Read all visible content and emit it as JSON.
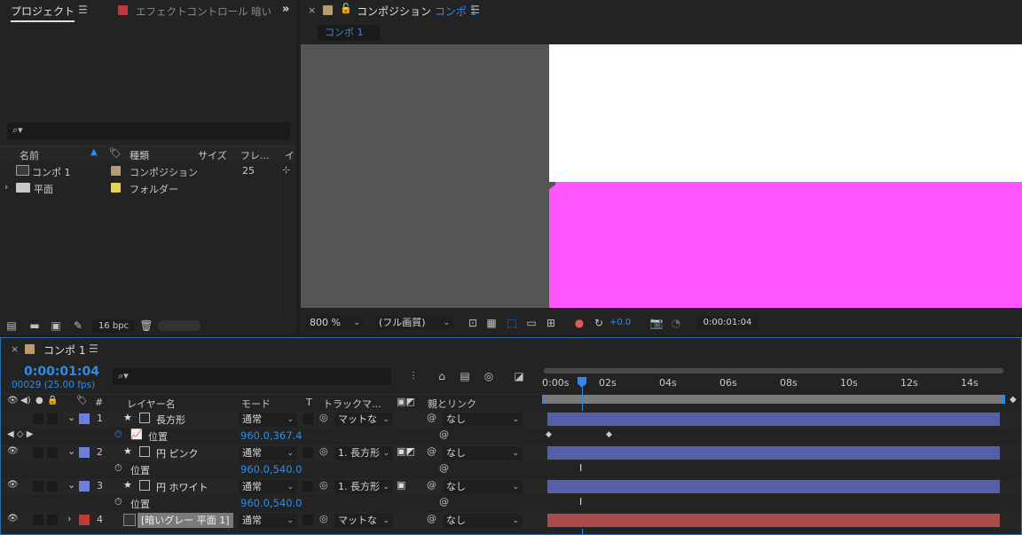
{
  "project_panel": {
    "tab_label": "プロジェクト",
    "effect_tab_label": "エフェクトコントロール 暗い",
    "columns": [
      "名前",
      "種類",
      "サイズ",
      "フレ...",
      "イ"
    ],
    "items": [
      {
        "name": "コンポ 1",
        "type": "コンポジション",
        "frame_rate": "25",
        "color": "#b89b72"
      },
      {
        "name": "平面",
        "type": "フォルダー",
        "frame_rate": "",
        "color": "#e8d44d"
      }
    ],
    "bpc_label": "16 bpc"
  },
  "comp_panel": {
    "tab_prefix": "コンポジション",
    "tab_name": "コンポ 1",
    "sub_tab": "コンポ 1",
    "zoom": "800 %",
    "resolution": "(フル画質)",
    "exposure": "+0.0",
    "timecode": "0:00:01:04"
  },
  "timeline": {
    "tab_label": "コンポ 1",
    "timecode": "0:00:01:04",
    "frame_info": "00029 (25.00 fps)",
    "headers": {
      "hash": "#",
      "layer_name": "レイヤー名",
      "mode": "モード",
      "t": "T",
      "track_matte": "トラックマ...",
      "parent": "親とリンク"
    },
    "ruler": [
      "0:00s",
      "02s",
      "04s",
      "06s",
      "08s",
      "10s",
      "12s",
      "14s"
    ],
    "playhead_fraction": 0.086,
    "layers": [
      {
        "num": "1",
        "name": "長方形",
        "mode": "通常",
        "matte": "マットな",
        "parent": "なし",
        "label_color": "#6b7fe0",
        "prop_name": "位置",
        "prop_value": "960.0,367.4",
        "bar_color": "#5560a6"
      },
      {
        "num": "2",
        "name": "円 ピンク",
        "mode": "通常",
        "matte": "1. 長方形",
        "parent": "なし",
        "label_color": "#6b7fe0",
        "prop_name": "位置",
        "prop_value": "960.0,540.0",
        "bar_color": "#5560a6"
      },
      {
        "num": "3",
        "name": "円 ホワイト",
        "mode": "通常",
        "matte": "1. 長方形",
        "parent": "なし",
        "label_color": "#6b7fe0",
        "prop_name": "位置",
        "prop_value": "960.0,540.0",
        "bar_color": "#5560a6"
      },
      {
        "num": "4",
        "name": "[暗いグレー 平面 1]",
        "mode": "通常",
        "matte": "マットな",
        "parent": "なし",
        "label_color": "#c03a3a",
        "bar_color": "#a84b4b"
      }
    ]
  },
  "colors": {
    "accent": "#2d8ceb",
    "pink": "#ff55ff",
    "viewer_gray": "#555555"
  }
}
